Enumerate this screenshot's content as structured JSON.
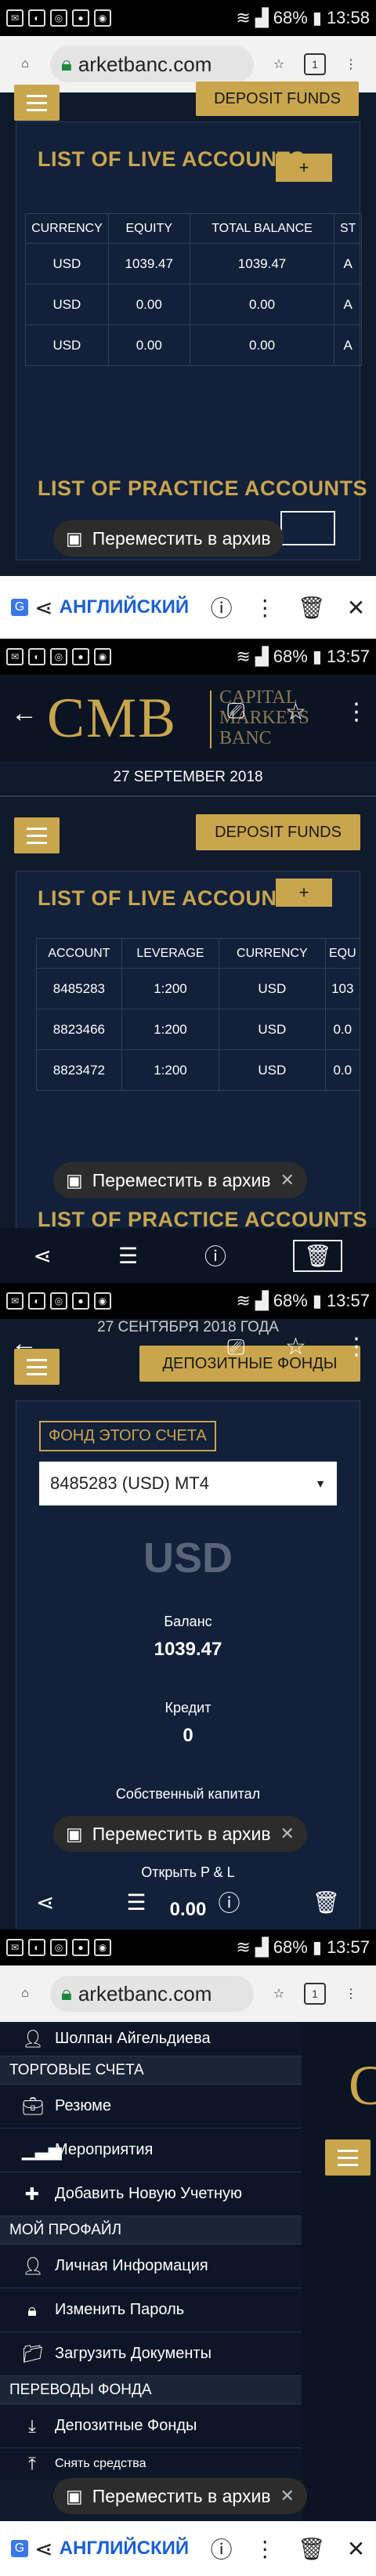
{
  "status_bar": [
    {
      "battery": "68%",
      "time": "13:58"
    },
    {
      "battery": "68%",
      "time": "13:57"
    },
    {
      "battery": "68%",
      "time": "13:57"
    },
    {
      "battery": "68%",
      "time": "13:57"
    }
  ],
  "browser": {
    "url": "arketbanc.com"
  },
  "deposit_funds": "DEPOSIT FUNDS",
  "live_accounts_title": "LIST OF LIVE ACCOUNTS",
  "practice_accounts_title": "LIST OF PRACTICE ACCOUNTS",
  "add_label": "+",
  "panel1_table": {
    "headers": [
      "CURRENCY",
      "EQUITY",
      "TOTAL BALANCE",
      "ST"
    ],
    "rows": [
      [
        "USD",
        "1039.47",
        "1039.47",
        "A"
      ],
      [
        "USD",
        "0.00",
        "0.00",
        "A"
      ],
      [
        "USD",
        "0.00",
        "0.00",
        "A"
      ]
    ]
  },
  "archive_snackbar": "Переместить в архив",
  "share_bar": {
    "language": "АНГЛИЙСКИЙ"
  },
  "logo": {
    "mark": "CMB",
    "line1": "CAPITAL",
    "line2": "MARKETS",
    "line3": "BANC"
  },
  "date_en": "27 SEPTEMBER 2018",
  "panel2_table": {
    "headers": [
      "ACCOUNT",
      "LEVERAGE",
      "CURRENCY",
      "EQU"
    ],
    "rows": [
      [
        "8485283",
        "1:200",
        "USD",
        "103"
      ],
      [
        "8823466",
        "1:200",
        "USD",
        "0.0"
      ],
      [
        "8823472",
        "1:200",
        "USD",
        "0.0"
      ]
    ]
  },
  "panel3": {
    "date_ru": "27 СЕНТЯБРЯ 2018 ГОДА",
    "deposit_ru": "ДЕПОЗИТНЫЕ ФОНДЫ",
    "fund_label": "ФОНД ЭТОГО СЧЕТА",
    "account_select": "8485283 (USD) MT4",
    "currency": "USD",
    "balance_label": "Баланс",
    "balance_value": "1039.47",
    "credit_label": "Кредит",
    "credit_value": "0",
    "equity_label": "Собственный капитал",
    "open_pl_label": "Открыть P & L",
    "open_pl_value": "0.00"
  },
  "menu": {
    "user": "Шолпан Айгельдиева",
    "sec_trading": "ТОРГОВЫЕ СЧЕТА",
    "summary": "Резюме",
    "events": "Мероприятия",
    "add_account": "Добавить Новую Учетную",
    "sec_profile": "МОЙ ПРОФАЙЛ",
    "personal_info": "Личная Информация",
    "change_password": "Изменить Пароль",
    "upload_docs": "Загрузить Документы",
    "sec_transfers": "ПЕРЕВОДЫ ФОНДА",
    "deposit_funds": "Депозитные Фонды",
    "withdraw_funds": "Снять средства"
  },
  "colors": {
    "gold": "#c9a54e",
    "navy": "#0f1a2b",
    "card": "#12203a"
  }
}
